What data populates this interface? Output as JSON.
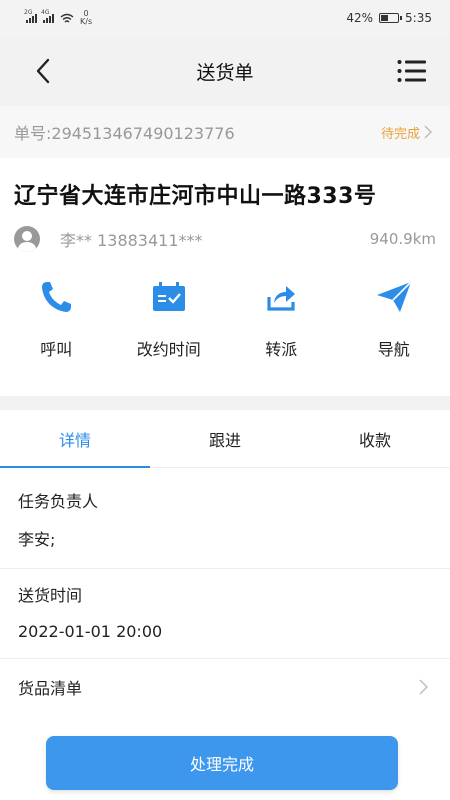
{
  "status_bar": {
    "signal1_tag": "2G",
    "signal2_tag": "4G",
    "speed_value": "0",
    "speed_unit": "K/s",
    "battery_percent": "42%",
    "time": "5:35"
  },
  "header": {
    "title": "送货单",
    "back_icon": "chevron-left-icon",
    "menu_icon": "list-menu-icon"
  },
  "order": {
    "order_no": "单号:29451346749012377 6",
    "order_no_text": "单号:294513467490123776",
    "status": "待完成",
    "address": "辽宁省大连市庄河市中山一路333号",
    "contact": "李** 13883411***",
    "distance": "940.9km"
  },
  "actions": [
    {
      "label": "呼叫",
      "icon": "phone-icon"
    },
    {
      "label": "改约时间",
      "icon": "calendar-icon"
    },
    {
      "label": "转派",
      "icon": "share-icon"
    },
    {
      "label": "导航",
      "icon": "navigation-icon"
    }
  ],
  "tabs": [
    {
      "label": "详情",
      "active": true
    },
    {
      "label": "跟进",
      "active": false
    },
    {
      "label": "收款",
      "active": false
    }
  ],
  "details": {
    "owner_label": "任务负责人",
    "owner_value": "李安;",
    "time_label": "送货时间",
    "time_value": "2022-01-01 20:00",
    "goods_label": "货品清单"
  },
  "submit_label": "处理完成",
  "colors": {
    "accent": "#2b8de8",
    "button": "#3d97ec",
    "status": "#e8a33c"
  }
}
